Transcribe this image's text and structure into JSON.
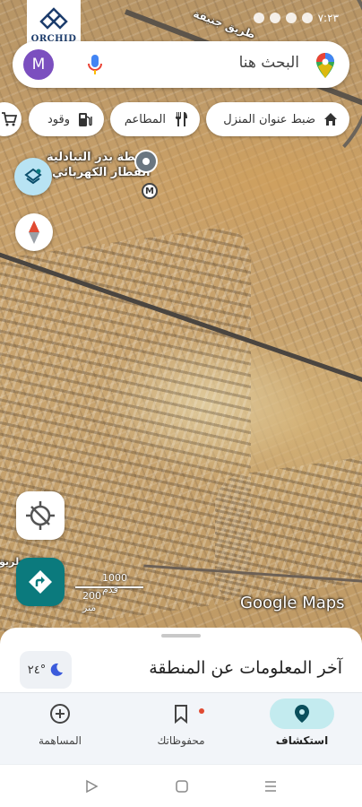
{
  "status_bar": {
    "time": "٧:٢٣"
  },
  "watermark": {
    "logo_text": "ORCHID"
  },
  "map": {
    "road_label_top": "طريق جنيفة",
    "station_label_line1": "محطة بدر التبادلية",
    "station_label_line2": "القطار الكهربائي",
    "metro_badge": "M",
    "road_label_left": "طريق",
    "scale_top": "1000 قدم",
    "scale_bottom": "200 متر",
    "attribution": "Google Maps"
  },
  "search": {
    "avatar_letter": "M",
    "placeholder": "البحث هنا"
  },
  "chips": [
    {
      "label": "ضبط عنوان المنزل",
      "icon": "home-icon"
    },
    {
      "label": "المطاعم",
      "icon": "restaurant-icon"
    },
    {
      "label": "وقود",
      "icon": "fuel-icon"
    },
    {
      "label": "",
      "icon": "shopping-cart-icon"
    }
  ],
  "sheet": {
    "title": "آخر المعلومات عن المنطقة",
    "temperature": "٢٤°"
  },
  "nav": {
    "explore": "استكشاف",
    "saved": "محفوظاتك",
    "contribute": "المساهمة"
  },
  "colors": {
    "accent_teal": "#0b7a7d",
    "nav_active": "#c3ebef",
    "avatar": "#7b4fbf"
  }
}
